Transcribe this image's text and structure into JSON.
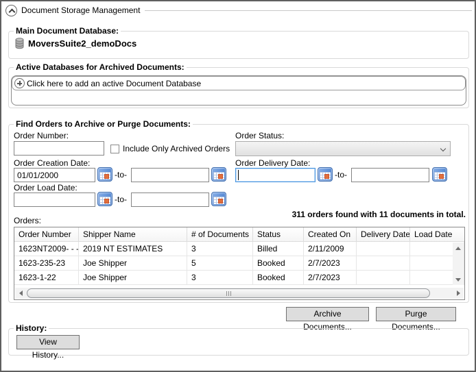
{
  "window": {
    "title": "Document Storage Management"
  },
  "main_database": {
    "label": "Main Document Database:",
    "name": "MoversSuite2_demoDocs"
  },
  "active_databases": {
    "label": "Active Databases for Archived Documents:",
    "add_prompt": "Click here to add an active Document Database"
  },
  "find_orders": {
    "label": "Find Orders to Archive or Purge Documents:",
    "order_number_label": "Order Number:",
    "order_number_value": "",
    "include_archived_label": "Include Only Archived Orders",
    "include_archived_checked": false,
    "order_status_label": "Order Status:",
    "order_status_value": "",
    "creation_date": {
      "label": "Order Creation Date:",
      "from": "01/01/2000",
      "to": "",
      "separator": "-to-"
    },
    "delivery_date": {
      "label": "Order Delivery Date:",
      "from": "",
      "to": "",
      "separator": "-to-"
    },
    "load_date": {
      "label": "Order Load Date:",
      "from": "",
      "to": "",
      "separator": "-to-"
    },
    "results_summary": "311 orders found with 11 documents in total.",
    "orders_label": "Orders:",
    "table": {
      "columns": [
        "Order Number",
        "Shipper Name",
        "# of Documents",
        "Status",
        "Created On",
        "Delivery Date",
        "Load Date"
      ],
      "rows": [
        [
          "1623NT2009- - -",
          "2019 NT ESTIMATES",
          "3",
          "Billed",
          "2/11/2009",
          "",
          ""
        ],
        [
          "1623-235-23",
          "Joe Shipper",
          "5",
          "Booked",
          "2/7/2023",
          "",
          ""
        ],
        [
          "1623-1-22",
          "Joe Shipper",
          "3",
          "Booked",
          "2/7/2023",
          "",
          ""
        ]
      ]
    }
  },
  "actions": {
    "archive_label": "Archive Documents...",
    "purge_label": "Purge Documents..."
  },
  "history": {
    "label": "History:",
    "view_button_label": "View History..."
  },
  "icons": {
    "header_toggle": "chevron-up-icon",
    "main_database": "database-icon",
    "add_database": "plus-circle-icon",
    "date_picker": "calendar-icon",
    "status_dropdown": "chevron-down-icon"
  },
  "colors": {
    "window_border": "#5f5f5f",
    "focus_border": "#4795e0",
    "calendar_blue": "#5b8dd6",
    "calendar_highlight": "#e0703c",
    "group_border": "#d9d9d9"
  }
}
